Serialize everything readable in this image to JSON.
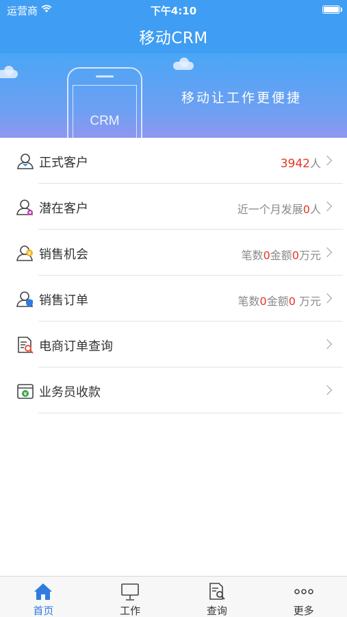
{
  "status_bar": {
    "carrier": "运营商",
    "time": "下午4:10"
  },
  "nav": {
    "title": "移动CRM"
  },
  "banner": {
    "phone_label": "CRM",
    "slogan": "移动让工作更便捷"
  },
  "colors": {
    "primary": "#3f9df3",
    "accent_red": "#ea3322",
    "tab_active": "#2f7be0"
  },
  "list": {
    "items": [
      {
        "label": "正式客户",
        "icon": "user-icon",
        "value_parts": [
          "",
          "3942",
          "人"
        ]
      },
      {
        "label": "潜在客户",
        "icon": "user-add-icon",
        "value_parts": [
          "近一个月发展",
          "0",
          "人"
        ]
      },
      {
        "label": "销售机会",
        "icon": "user-coin-icon",
        "value_parts": [
          "笔数",
          "0",
          "金额",
          "0",
          "万元"
        ]
      },
      {
        "label": "销售订单",
        "icon": "user-shield-icon",
        "value_parts": [
          "笔数",
          "0",
          "金额",
          "0",
          " 万元"
        ]
      },
      {
        "label": "电商订单查询",
        "icon": "document-search-icon",
        "value_parts": []
      },
      {
        "label": "业务员收款",
        "icon": "wallet-icon",
        "value_parts": []
      }
    ]
  },
  "tabs": [
    {
      "label": "首页",
      "icon": "home-icon",
      "active": true
    },
    {
      "label": "工作",
      "icon": "monitor-icon",
      "active": false
    },
    {
      "label": "查询",
      "icon": "search-document-icon",
      "active": false
    },
    {
      "label": "更多",
      "icon": "more-icon",
      "active": false
    }
  ]
}
